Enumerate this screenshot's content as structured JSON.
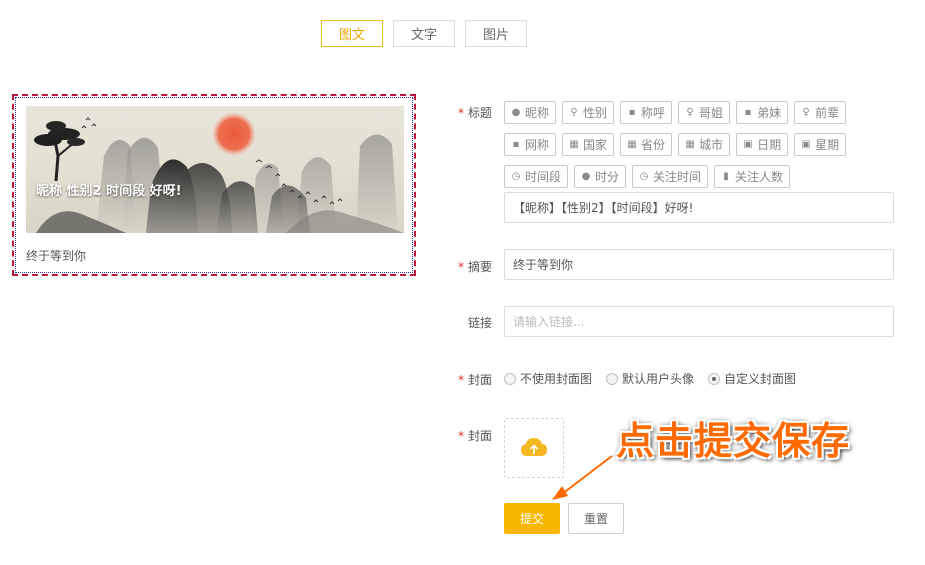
{
  "tabs": [
    {
      "label": "图文",
      "active": true
    },
    {
      "label": "文字",
      "active": false
    },
    {
      "label": "图片",
      "active": false
    }
  ],
  "preview": {
    "title": "昵称 性别2 时间段 好呀!",
    "summary": "终于等到你"
  },
  "form": {
    "title_label": "标题",
    "summary_label": "摘要",
    "link_label": "链接",
    "cover_type_label": "封面",
    "cover_label": "封面",
    "tags_row1": [
      {
        "label": "昵称",
        "icon": "user-icon"
      },
      {
        "label": "性别",
        "icon": "gender-icon"
      },
      {
        "label": "称呼",
        "icon": "person-icon"
      },
      {
        "label": "哥姐",
        "icon": "female-icon"
      },
      {
        "label": "弟妹",
        "icon": "person-icon"
      },
      {
        "label": "前辈",
        "icon": "female-icon"
      }
    ],
    "tags_row2": [
      {
        "label": "网称",
        "icon": "person-icon"
      },
      {
        "label": "国家",
        "icon": "map-icon"
      },
      {
        "label": "省份",
        "icon": "map-icon"
      },
      {
        "label": "城市",
        "icon": "map-icon"
      },
      {
        "label": "日期",
        "icon": "calendar-icon"
      },
      {
        "label": "星期",
        "icon": "calendar-icon"
      }
    ],
    "tags_row3": [
      {
        "label": "时间段",
        "icon": "timer-icon"
      },
      {
        "label": "时分",
        "icon": "clock-fill-icon"
      },
      {
        "label": "关注时间",
        "icon": "clock-icon"
      },
      {
        "label": "关注人数",
        "icon": "doc-icon"
      }
    ],
    "title_value": "【昵称】【性别2】【时间段】好呀!",
    "summary_value": "终于等到你",
    "link_placeholder": "请输入链接...",
    "cover_options": [
      {
        "label": "不使用封面图",
        "selected": false
      },
      {
        "label": "默认用户头像",
        "selected": false
      },
      {
        "label": "自定义封面图",
        "selected": true
      }
    ],
    "submit_label": "提交",
    "reset_label": "重置"
  },
  "annotation": "点击提交保存",
  "colors": {
    "accent": "#f9b600",
    "required": "#e0302a",
    "annotation": "#ff6a00",
    "upload_icon": "#f5b820"
  }
}
